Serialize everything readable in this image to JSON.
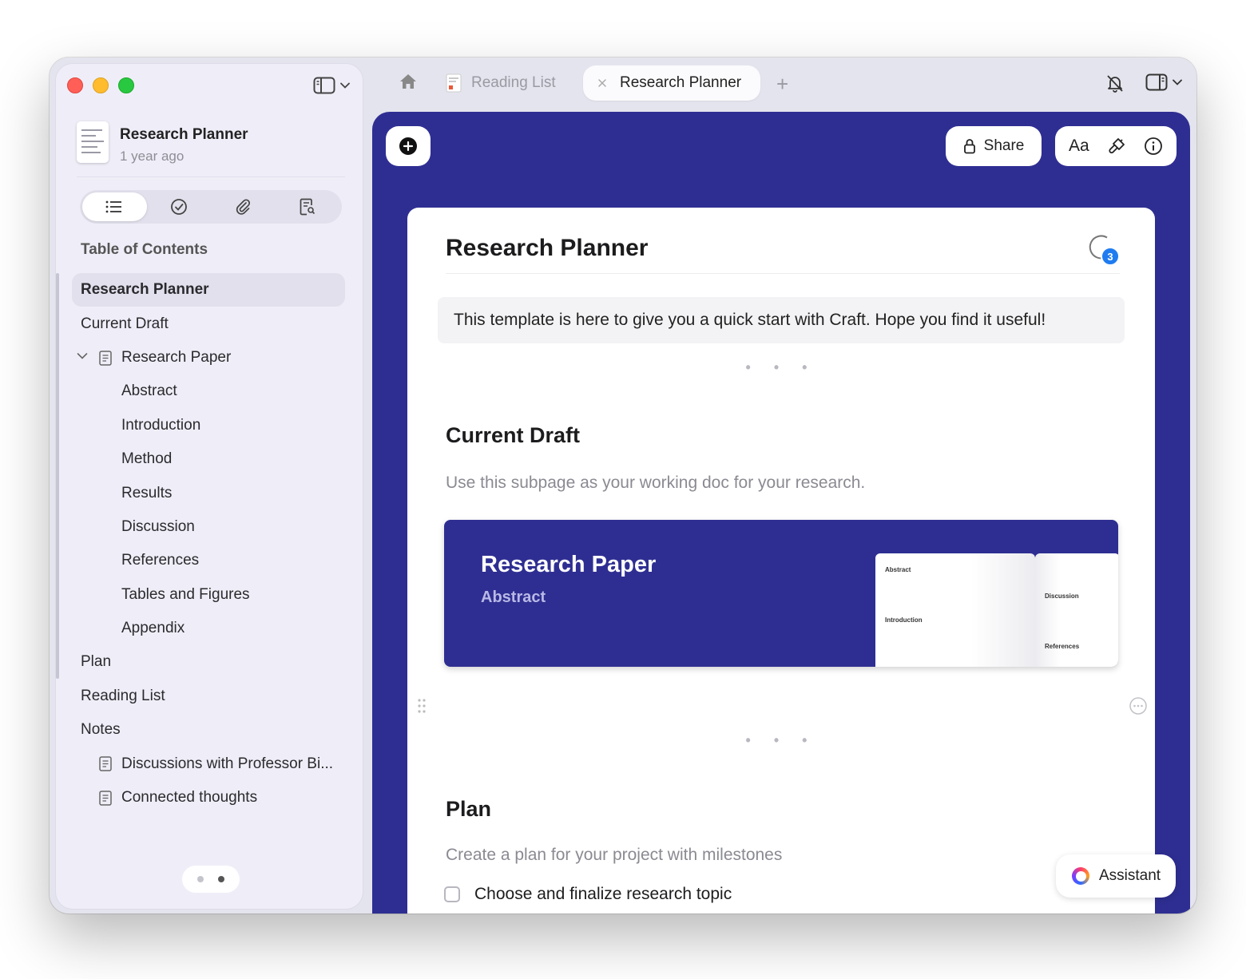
{
  "sidebar": {
    "doc_title": "Research Planner",
    "doc_subtitle": "1 year ago",
    "segments": [
      "list-icon",
      "check-circle-icon",
      "paperclip-icon",
      "search-document-icon"
    ],
    "toc_heading": "Table of Contents",
    "toc": [
      {
        "label": "Research Planner",
        "level": 0,
        "active": true
      },
      {
        "label": "Current Draft",
        "level": 0
      },
      {
        "label": "Research Paper",
        "level": 1,
        "expanded": true
      },
      {
        "label": "Abstract",
        "level": 2
      },
      {
        "label": "Introduction",
        "level": 2
      },
      {
        "label": "Method",
        "level": 2
      },
      {
        "label": "Results",
        "level": 2
      },
      {
        "label": "Discussion",
        "level": 2
      },
      {
        "label": "References",
        "level": 2
      },
      {
        "label": "Tables and Figures",
        "level": 2
      },
      {
        "label": "Appendix",
        "level": 2
      },
      {
        "label": "Plan",
        "level": 0
      },
      {
        "label": "Reading List",
        "level": 0
      },
      {
        "label": "Notes",
        "level": 0
      },
      {
        "label": "Discussions with Professor Bi...",
        "level": 1
      },
      {
        "label": "Connected thoughts",
        "level": 1
      }
    ]
  },
  "tabs": {
    "inactive_label": "Reading List",
    "active_label": "Research Planner",
    "new_tab_symbol": "+"
  },
  "toolbar": {
    "share_label": "Share",
    "font_label": "Aa"
  },
  "page": {
    "title": "Research Planner",
    "comment_count": "3",
    "callout": "This template is here to give you a quick start with Craft. Hope you find it useful!",
    "separator": "• • •",
    "section1_title": "Current Draft",
    "section1_text": "Use this subpage as your working doc for your research.",
    "card": {
      "title": "Research Paper",
      "subtitle": "Abstract",
      "preview_left_top": "Abstract",
      "preview_left_mid": "Introduction",
      "preview_right_top": "Discussion",
      "preview_right_bottom": "References"
    },
    "section2_title": "Plan",
    "section2_text": "Create a plan for your project with milestones",
    "task1": "Choose and finalize research topic"
  },
  "assistant_label": "Assistant",
  "colors": {
    "accent": "#2e2e92",
    "badge": "#1f7cf0"
  }
}
